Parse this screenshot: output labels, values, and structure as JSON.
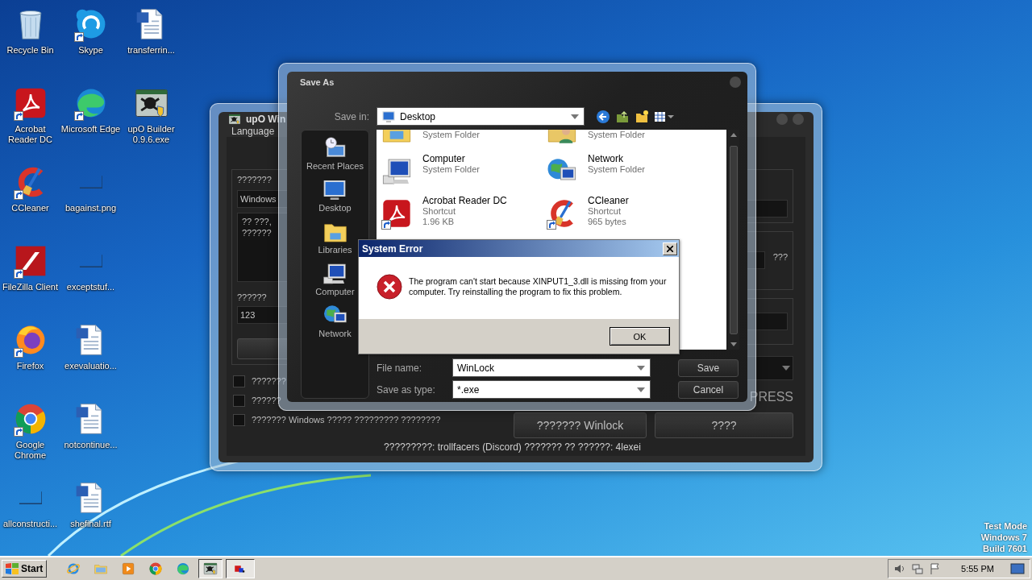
{
  "desktop": {
    "columns": [
      [
        {
          "label": "Recycle Bin",
          "kind": "recycle",
          "shortcut": false
        },
        {
          "label": "Acrobat\nReader DC",
          "kind": "reader",
          "shortcut": true
        },
        {
          "label": "CCleaner",
          "kind": "broom",
          "shortcut": true
        },
        {
          "label": "FileZilla Client",
          "kind": "filezilla",
          "shortcut": true
        },
        {
          "label": "Firefox",
          "kind": "firefox",
          "shortcut": true
        },
        {
          "label": "Google\nChrome",
          "kind": "chrome",
          "shortcut": true
        },
        {
          "label": "allconstructi...",
          "kind": "blank",
          "shortcut": false
        }
      ],
      [
        {
          "label": "Skype",
          "kind": "chat",
          "shortcut": true
        },
        {
          "label": "Microsoft Edge",
          "kind": "edge",
          "shortcut": true
        },
        {
          "label": "bagainst.png",
          "kind": "blank",
          "shortcut": false
        },
        {
          "label": "exceptstuf...",
          "kind": "blank",
          "shortcut": false
        },
        {
          "label": "exevaluatio...",
          "kind": "doc",
          "shortcut": false
        },
        {
          "label": "notcontinue...",
          "kind": "doc",
          "shortcut": false
        },
        {
          "label": "shefinal.rtf",
          "kind": "doc",
          "shortcut": false
        }
      ],
      [
        {
          "label": "transferrin...",
          "kind": "doc",
          "shortcut": false
        },
        {
          "label": "upO Builder\n0.9.6.exe",
          "kind": "skull",
          "shortcut": false
        }
      ]
    ],
    "edition_notice": [
      "Test Mode",
      "Windows 7",
      "Build 7601"
    ]
  },
  "builder_window": {
    "title": "upO Win",
    "menu": [
      "Language"
    ],
    "source_label": "???????",
    "source_field": "Windows",
    "message_lines": [
      "?? ???,",
      "??????"
    ],
    "count_label": "??????",
    "count_field": "123",
    "options": [
      {
        "label": "???????",
        "checked": false
      },
      {
        "label": "??????",
        "checked": false
      },
      {
        "label": "??????? Windows ????? ????????? ????????",
        "checked": false
      }
    ],
    "side_label": "???",
    "compress_label": "PRESS",
    "buttons": [
      "??????? Winlock",
      "????"
    ],
    "footer": "?????????: trollfacers (Discord) ??????? ?? ??????: 4lexei"
  },
  "save_dialog": {
    "title": "Save As",
    "save_in_label": "Save in:",
    "save_in_value": "Desktop",
    "places": [
      {
        "label": "Recent Places",
        "kind": "recent"
      },
      {
        "label": "Desktop",
        "kind": "monitor"
      },
      {
        "label": "Libraries",
        "kind": "libraries"
      },
      {
        "label": "Computer",
        "kind": "computer"
      },
      {
        "label": "Network",
        "kind": "network"
      }
    ],
    "files": [
      {
        "kind": "libraries",
        "details": [
          "System Folder"
        ],
        "shortcut": false
      },
      {
        "kind": "user",
        "details": [
          "System Folder"
        ],
        "shortcut": false
      },
      {
        "kind": "computer",
        "name": "Computer",
        "details": [
          "System Folder"
        ],
        "shortcut": false
      },
      {
        "kind": "network",
        "name": "Network",
        "details": [
          "System Folder"
        ],
        "shortcut": false
      },
      {
        "kind": "reader",
        "name": "Acrobat Reader DC",
        "details": [
          "Shortcut",
          "1.96 KB"
        ],
        "shortcut": true
      },
      {
        "kind": "broom",
        "name": "CCleaner",
        "details": [
          "Shortcut",
          "965 bytes"
        ],
        "shortcut": true
      }
    ],
    "file_name_label": "File name:",
    "file_name": "WinLock",
    "type_label": "Save as type:",
    "type_value": "*.exe",
    "buttons": [
      "Save",
      "Cancel"
    ]
  },
  "error_dialog": {
    "title": "System Error",
    "message": "The program can't start because XINPUT1_3.dll is missing from your computer. Try reinstalling the program to fix this problem.",
    "button": "OK"
  },
  "taskbar": {
    "start": "Start",
    "apps": [
      {
        "kind": "ie",
        "active": false
      },
      {
        "kind": "explorer",
        "active": false
      },
      {
        "kind": "media",
        "active": false
      },
      {
        "kind": "chrome",
        "active": false
      },
      {
        "kind": "edge",
        "active": false
      },
      {
        "kind": "skull",
        "active": true
      },
      {
        "kind": "app",
        "active": true
      }
    ],
    "clock": "5:55 PM"
  }
}
